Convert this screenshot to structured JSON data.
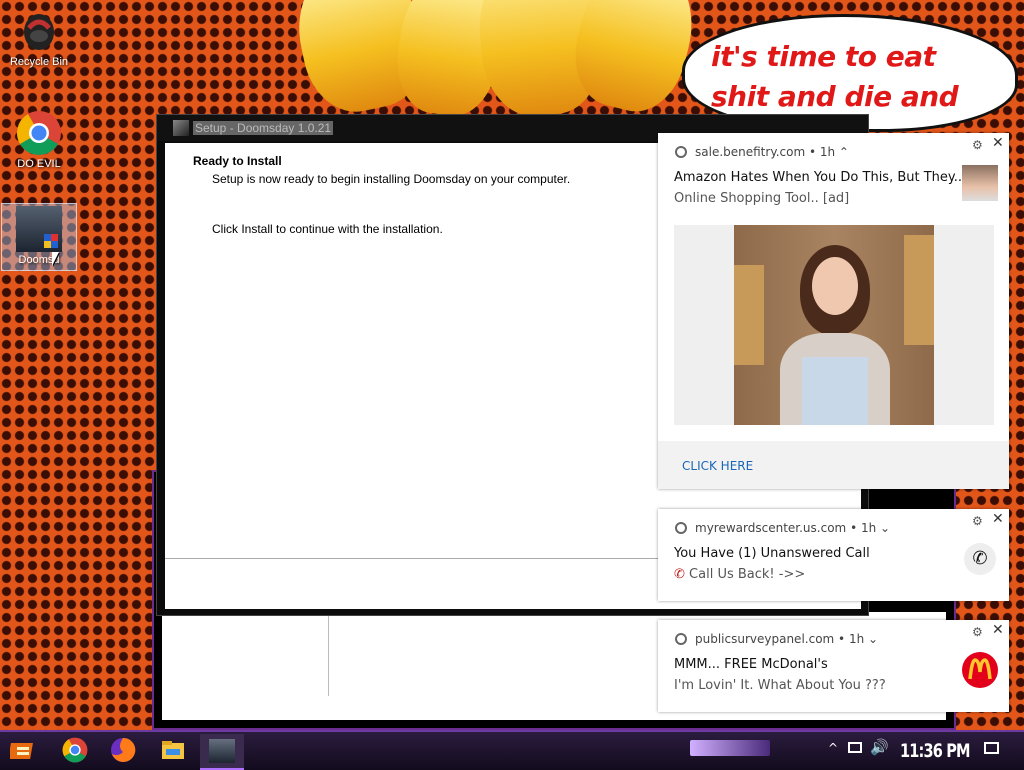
{
  "desktop": {
    "icons": [
      {
        "label": "Recycle Bin"
      },
      {
        "label": "DO EVIL"
      },
      {
        "label": "Doomsd"
      }
    ],
    "wallpaper_text": "it's time to eat shit and die and chew"
  },
  "setup_window": {
    "title": "Setup - Doomsday 1.0.21",
    "heading": "Ready to Install",
    "subheading": "Setup is now ready to begin installing Doomsday on your computer.",
    "body": "Click Install to continue with the installation."
  },
  "notifications": [
    {
      "source": "sale.benefitry.com",
      "time": "• 1h ⌃",
      "title": "Amazon Hates When You Do This, But They...",
      "subtitle": "Online Shopping Tool.. [ad]",
      "action": "CLICK HERE"
    },
    {
      "source": "myrewardscenter.us.com",
      "time": "• 1h ⌄",
      "title": "You Have (1) Unanswered Call",
      "subtitle": "Call Us Back! ->>"
    },
    {
      "source": "publicsurveypanel.com",
      "time": "• 1h ⌄",
      "title": "MMM... FREE McDonal's",
      "subtitle": "I'm Lovin' It. What About You ???"
    }
  ],
  "taskbar": {
    "clock": "11:36 PM"
  },
  "colors": {
    "accent_link": "#1a66b8",
    "taskbar_border": "#6b3b9f",
    "mcdonalds_red": "#e2001a",
    "mcdonalds_yellow": "#ffc72c"
  }
}
